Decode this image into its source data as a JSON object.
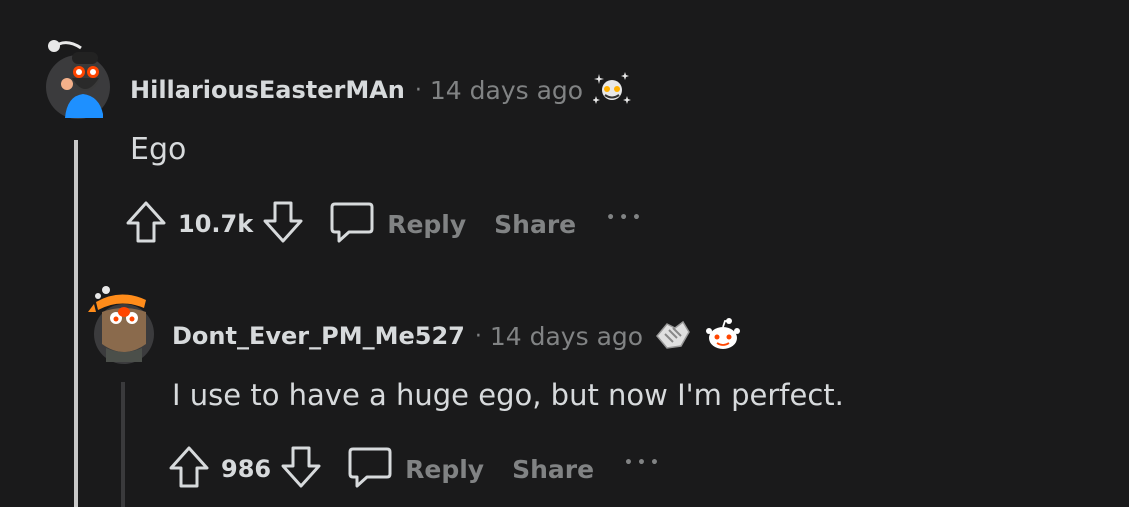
{
  "comments": [
    {
      "username": "HillariousEasterMAn",
      "separator": "·",
      "time": "14 days ago",
      "body": "Ego",
      "votes": "10.7k",
      "reply_label": "Reply",
      "share_label": "Share",
      "more_label": "•••"
    },
    {
      "username": "Dont_Ever_PM_Me527",
      "separator": "·",
      "time": "14 days ago",
      "body": "I use to have a huge ego, but now I'm perfect.",
      "votes": "986",
      "reply_label": "Reply",
      "share_label": "Share",
      "more_label": "•••"
    }
  ],
  "colors": {
    "background": "#1a1a1b",
    "text_primary": "#d7dadc",
    "text_secondary": "#818384",
    "thread_line": "#c8c8c8"
  }
}
